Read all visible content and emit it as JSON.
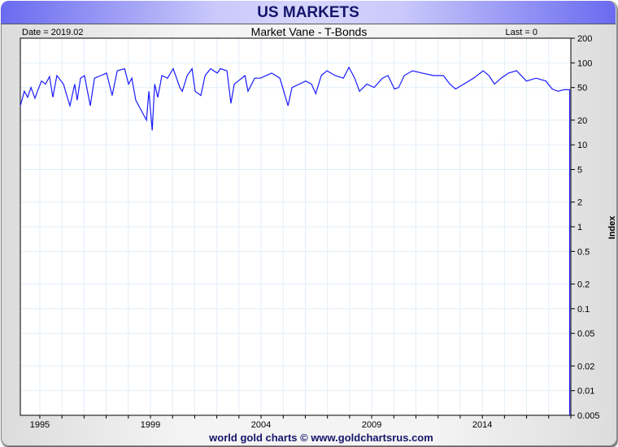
{
  "header": {
    "title": "US MARKETS"
  },
  "footer": {
    "credit": "world gold charts © www.goldchartsrus.com"
  },
  "colors": {
    "line": "#1a1aff",
    "grid": "#e2eef8",
    "title": "#15156a"
  },
  "chart_data": {
    "type": "line",
    "title": "Market Vane - T-Bonds",
    "date_label": "Date = 2019.02",
    "last_label": "Last = 0",
    "xlabel": "",
    "ylabel": "Index",
    "yscale": "log",
    "ylim": [
      0.005,
      200
    ],
    "xlim": [
      1994.12,
      2019.0
    ],
    "grid": true,
    "y_ticks": [
      200,
      100,
      50,
      20,
      10,
      5,
      2,
      1,
      0.5,
      0.2,
      0.1,
      0.05,
      0.02,
      0.01,
      0.005
    ],
    "y_tick_labels": [
      "200",
      "100",
      "50",
      "20",
      "10",
      "5",
      "2",
      "1",
      "0.5",
      "0.2",
      "0.1",
      "0.05",
      "0.02",
      "0.01",
      "0.005"
    ],
    "x_ticks": [
      1995,
      1996,
      1997,
      1998,
      1999,
      2000,
      2001,
      2002,
      2003,
      2004,
      2005,
      2006,
      2007,
      2008,
      2009,
      2010,
      2011,
      2012,
      2013,
      2014,
      2015,
      2016,
      2017,
      2018,
      2019
    ],
    "x_tick_labels": [
      {
        "x": 1995,
        "label": "1995"
      },
      {
        "x": 2000,
        "label": "1999"
      },
      {
        "x": 2005,
        "label": "2004"
      },
      {
        "x": 2010,
        "label": "2009"
      },
      {
        "x": 2015,
        "label": "2014"
      }
    ],
    "series": [
      {
        "name": "Market Vane - T-Bonds",
        "x": [
          1994.12,
          1994.19,
          1994.3,
          1994.45,
          1994.6,
          1994.78,
          1994.89,
          1995.08,
          1995.26,
          1995.44,
          1995.59,
          1995.77,
          1996.07,
          1996.22,
          1996.36,
          1996.58,
          1996.69,
          1996.84,
          1997.02,
          1997.28,
          1997.47,
          1997.76,
          1998.02,
          1998.27,
          1998.5,
          1998.83,
          1999.01,
          1999.16,
          1999.34,
          1999.63,
          1999.82,
          1999.93,
          2000.08,
          2000.19,
          2000.33,
          2000.52,
          2000.77,
          2001.03,
          2001.33,
          2001.44,
          2001.66,
          2001.88,
          2002.02,
          2002.28,
          2002.47,
          2002.72,
          2003.02,
          2003.16,
          2003.46,
          2003.64,
          2003.79,
          2003.97,
          2004.27,
          2004.41,
          2004.71,
          2004.97,
          2005.48,
          2005.85,
          2006.22,
          2006.4,
          2006.73,
          2007.02,
          2007.28,
          2007.47,
          2007.72,
          2007.98,
          2008.35,
          2008.72,
          2008.97,
          2009.23,
          2009.45,
          2009.78,
          2010.11,
          2010.48,
          2010.74,
          2011.03,
          2011.22,
          2011.47,
          2011.84,
          2012.28,
          2012.8,
          2013.24,
          2013.53,
          2013.79,
          2014.16,
          2014.6,
          2015.04,
          2015.3,
          2015.55,
          2015.85,
          2016.18,
          2016.55,
          2016.99,
          2017.43,
          2017.87,
          2018.16,
          2018.42,
          2018.68,
          2018.9,
          2018.95,
          2018.95
        ],
        "values": [
          30,
          35,
          45,
          38,
          50,
          37,
          45,
          60,
          55,
          68,
          38,
          70,
          55,
          40,
          30,
          55,
          35,
          65,
          70,
          30,
          65,
          70,
          75,
          40,
          80,
          85,
          55,
          65,
          35,
          25,
          20,
          45,
          15,
          55,
          38,
          70,
          65,
          85,
          50,
          45,
          70,
          85,
          45,
          40,
          70,
          85,
          75,
          85,
          80,
          32,
          55,
          60,
          70,
          45,
          65,
          65,
          75,
          65,
          30,
          50,
          55,
          60,
          55,
          42,
          70,
          80,
          70,
          65,
          88,
          65,
          45,
          55,
          50,
          65,
          70,
          48,
          50,
          70,
          80,
          75,
          70,
          70,
          55,
          48,
          55,
          65,
          80,
          70,
          55,
          65,
          75,
          80,
          60,
          65,
          60,
          48,
          45,
          47,
          47,
          47,
          0.005
        ]
      }
    ]
  }
}
